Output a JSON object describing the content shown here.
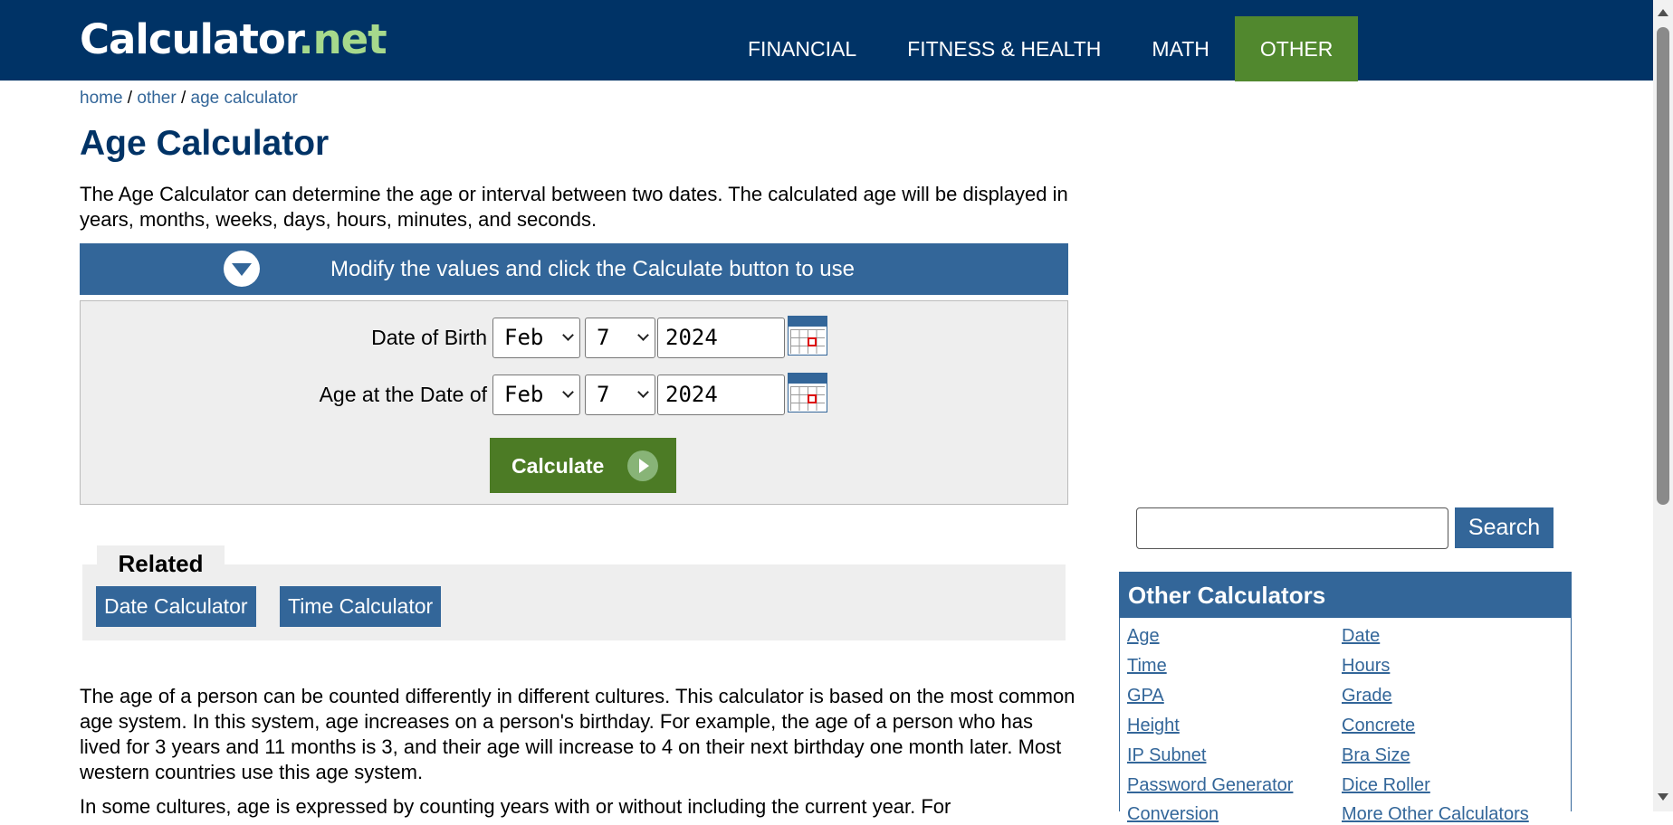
{
  "header": {
    "logo_main": "Calculator",
    "logo_suffix": ".net",
    "nav": [
      "FINANCIAL",
      "FITNESS & HEALTH",
      "MATH",
      "OTHER"
    ]
  },
  "breadcrumb": {
    "home": "home",
    "sep": " / ",
    "other": "other",
    "current": "age calculator"
  },
  "page": {
    "title": "Age Calculator",
    "intro": "The Age Calculator can determine the age or interval between two dates. The calculated age will be displayed in years, months, weeks, days, hours, minutes, and seconds."
  },
  "form": {
    "banner": "Modify the values and click the Calculate button to use",
    "dob_label": "Date of Birth",
    "dob_month": "Feb",
    "dob_day": "7",
    "dob_year": "2024",
    "at_label": "Age at the Date of",
    "at_month": "Feb",
    "at_day": "7",
    "at_year": "2024",
    "calculate": "Calculate"
  },
  "related": {
    "title": "Related",
    "links": [
      "Date Calculator",
      "Time Calculator"
    ]
  },
  "body": {
    "p1": "The age of a person can be counted differently in different cultures. This calculator is based on the most common age system. In this system, age increases on a person's birthday. For example, the age of a person who has lived for 3 years and 11 months is 3, and their age will increase to 4 on their next birthday one month later. Most western countries use this age system.",
    "p2": "In some cultures, age is expressed by counting years with or without including the current year. For"
  },
  "sidebar": {
    "search_value": "",
    "search_button": "Search",
    "other_title": "Other Calculators",
    "left_links": [
      "Age",
      "Time",
      "GPA",
      "Height",
      "IP Subnet",
      "Password Generator",
      "Conversion"
    ],
    "right_links": [
      "Date",
      "Hours",
      "Grade",
      "Concrete",
      "Bra Size",
      "Dice Roller",
      "More Other Calculators"
    ]
  },
  "colors": {
    "header_bg": "#003366",
    "accent_blue": "#336699",
    "nav_active": "#51882e",
    "button_green": "#4c7b25",
    "logo_net": "#a6d98c"
  }
}
